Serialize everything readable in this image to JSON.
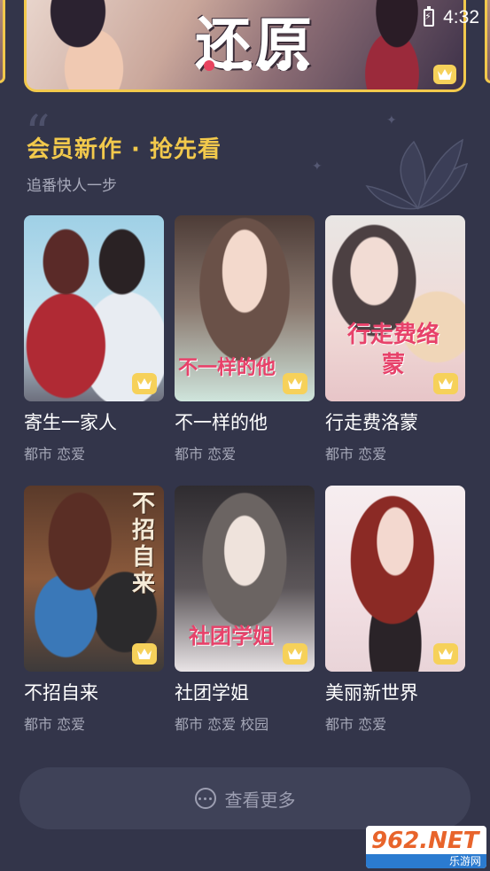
{
  "status_bar": {
    "time": "4:32"
  },
  "banner": {
    "title": "还原",
    "dots": 6,
    "active_dot": 0
  },
  "section": {
    "title": "会员新作 · 抢先看",
    "subtitle": "追番快人一步"
  },
  "comics": [
    {
      "title": "寄生一家人",
      "tags": "都市 恋爱",
      "cover_text": "",
      "vip": true
    },
    {
      "title": "不一样的他",
      "tags": "都市 恋爱",
      "cover_text": "不一样的他",
      "vip": true
    },
    {
      "title": "行走费洛蒙",
      "tags": "都市 恋爱",
      "cover_text": "行走费络蒙",
      "vip": true
    },
    {
      "title": "不招自来",
      "tags": "都市 恋爱",
      "cover_text": "不招自来",
      "vip": true
    },
    {
      "title": "社团学姐",
      "tags": "都市 恋爱 校园",
      "cover_text": "社团学姐",
      "vip": true
    },
    {
      "title": "美丽新世界",
      "tags": "都市 恋爱",
      "cover_text": "",
      "vip": true
    }
  ],
  "more_button": {
    "label": "查看更多",
    "icon": "ellipsis-circle-icon"
  },
  "watermark": {
    "main": "962.NET",
    "sub": "乐游网"
  },
  "colors": {
    "background": "#33354a",
    "accent_gold": "#f2c94c",
    "active_dot": "#e8435f",
    "secondary_text": "#a6a8b8"
  }
}
